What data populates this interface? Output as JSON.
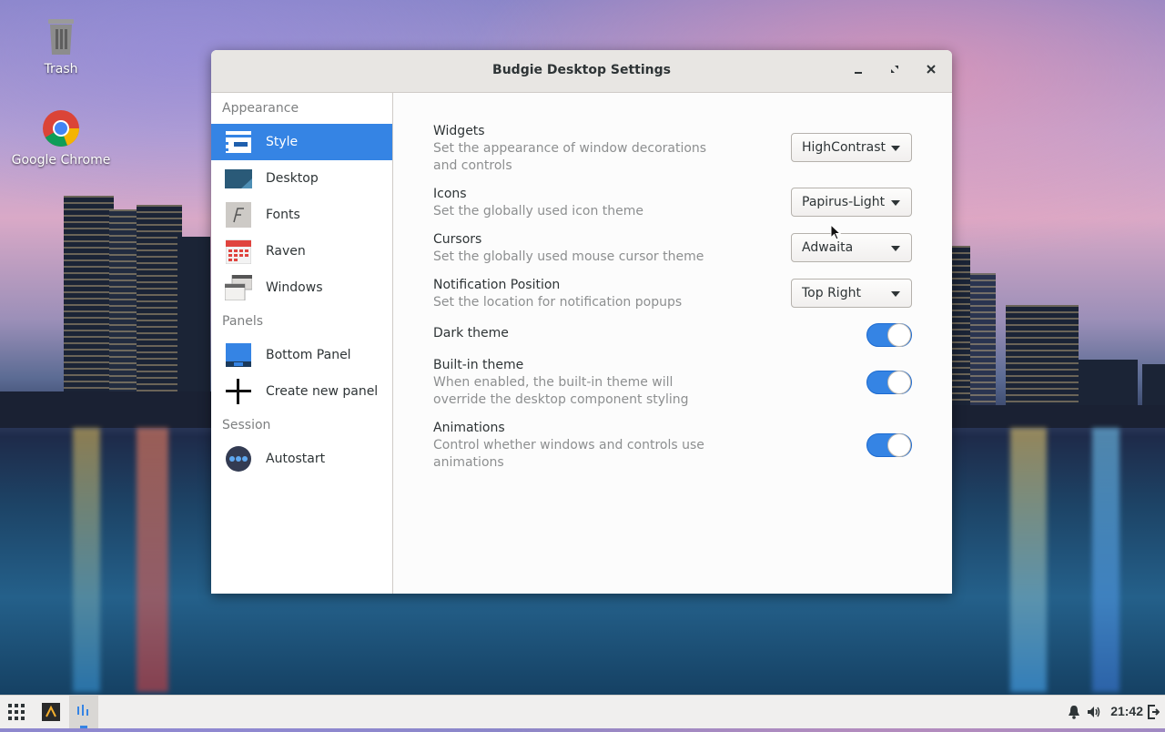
{
  "desktop": {
    "icons": [
      {
        "label": "Trash",
        "icon": "trash-icon"
      },
      {
        "label": "Google Chrome",
        "icon": "chrome-icon"
      }
    ]
  },
  "window": {
    "title": "Budgie Desktop Settings",
    "controls": [
      "minimize-icon",
      "maximize-icon",
      "close-icon"
    ]
  },
  "sidebar": {
    "sections": [
      {
        "label": "Appearance",
        "items": [
          {
            "label": "Style",
            "active": true,
            "icon": "style-icon"
          },
          {
            "label": "Desktop",
            "icon": "desktop-icon"
          },
          {
            "label": "Fonts",
            "icon": "fonts-icon"
          },
          {
            "label": "Raven",
            "icon": "calendar-icon"
          },
          {
            "label": "Windows",
            "icon": "windows-icon"
          }
        ]
      },
      {
        "label": "Panels",
        "items": [
          {
            "label": "Bottom Panel",
            "icon": "panel-icon"
          },
          {
            "label": "Create new panel",
            "icon": "plus-icon"
          }
        ]
      },
      {
        "label": "Session",
        "items": [
          {
            "label": "Autostart",
            "icon": "autostart-icon"
          }
        ]
      }
    ]
  },
  "settings": {
    "widgets": {
      "label": "Widgets",
      "desc": "Set the appearance of window decorations and controls",
      "value": "HighContrast"
    },
    "icons": {
      "label": "Icons",
      "desc": "Set the globally used icon theme",
      "value": "Papirus-Light"
    },
    "cursors": {
      "label": "Cursors",
      "desc": "Set the globally used mouse cursor theme",
      "value": "Adwaita"
    },
    "notification": {
      "label": "Notification Position",
      "desc": "Set the location for notification popups",
      "value": "Top Right"
    },
    "dark_theme": {
      "label": "Dark theme",
      "on": true
    },
    "builtin_theme": {
      "label": "Built-in theme",
      "desc": "When enabled, the built-in theme will override the desktop component styling",
      "on": true
    },
    "animations": {
      "label": "Animations",
      "desc": "Control whether windows and controls use animations",
      "on": true
    }
  },
  "panel": {
    "clock": "21:42",
    "left_icons": [
      "apps-grid-icon",
      "terminal-icon",
      "settings-task-icon"
    ],
    "right_icons": [
      "bell-icon",
      "volume-icon",
      "logout-icon"
    ]
  },
  "colors": {
    "accent": "#3584e4"
  }
}
